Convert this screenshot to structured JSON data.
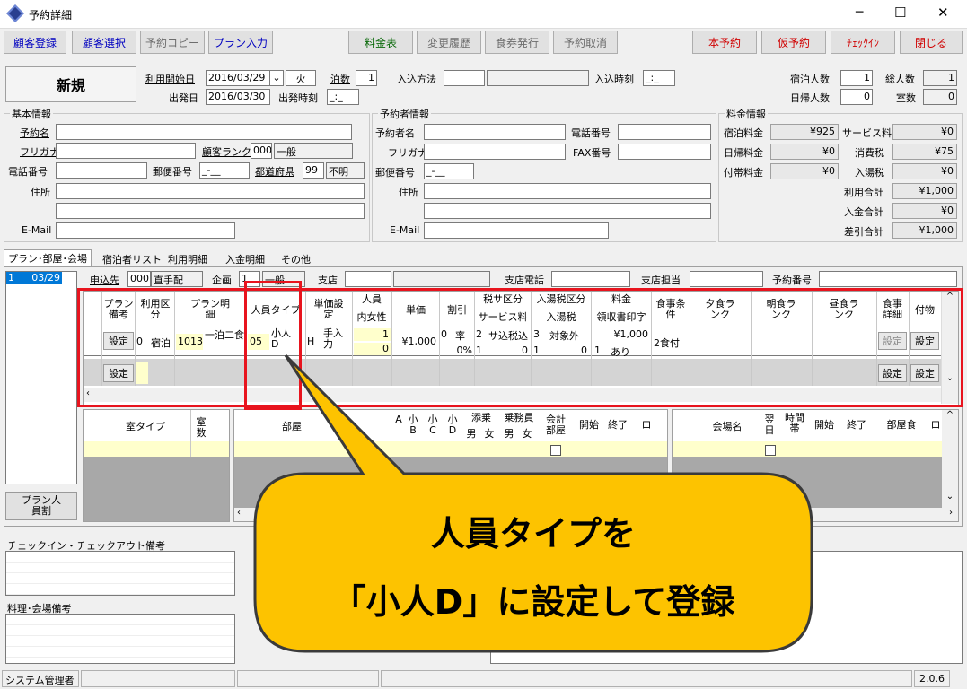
{
  "window": {
    "title": "予約詳細",
    "buttons": [
      "─",
      "☐",
      "✕"
    ]
  },
  "toolbar": {
    "left": [
      "顧客登録",
      "顧客選択",
      "予約コピー",
      "プラン入力"
    ],
    "center": [
      "料金表",
      "変更履歴",
      "食券発行",
      "予約取消"
    ],
    "right": [
      "本予約",
      "仮予約",
      "ﾁｪｯｸｲﾝ",
      "閉じる"
    ]
  },
  "header": {
    "status": "新規",
    "start_date_label": "利用開始日",
    "start_date": "2016/03/29",
    "weekday": "火",
    "nights_label": "泊数",
    "nights": "1",
    "checkin_method_label": "入込方法",
    "checkin_time_label": "入込時刻",
    "checkin_time": "_:_",
    "depart_date_label": "出発日",
    "depart_date": "2016/03/30",
    "depart_time_label": "出発時刻",
    "depart_time": "_:_",
    "stay_people_label": "宿泊人数",
    "stay_people": "1",
    "total_people_label": "総人数",
    "total_people": "1",
    "day_people_label": "日帰人数",
    "day_people": "0",
    "rooms_label": "室数",
    "rooms": "0"
  },
  "basic": {
    "title": "基本情報",
    "name_label": "予約名",
    "kana_label": "フリガナ",
    "rank_label": "顧客ランク",
    "rank_code": "000",
    "rank_name": "一般",
    "phone_label": "電話番号",
    "zip_label": "郵便番号",
    "zip": "_-__",
    "pref_label": "都道府県",
    "pref_code": "99",
    "pref_name": "不明",
    "address_label": "住所",
    "email_label": "E-Mail"
  },
  "booker": {
    "title": "予約者情報",
    "name_label": "予約者名",
    "phone_label": "電話番号",
    "kana_label": "フリガナ",
    "fax_label": "FAX番号",
    "zip_label": "郵便番号",
    "zip": "_-__",
    "address_label": "住所",
    "email_label": "E-Mail"
  },
  "fees": {
    "title": "料金情報",
    "rows": [
      {
        "l1": "宿泊料金",
        "v1": "¥925",
        "l2": "サービス料",
        "v2": "¥0"
      },
      {
        "l1": "日帰料金",
        "v1": "¥0",
        "l2": "消費税",
        "v2": "¥75"
      },
      {
        "l1": "付帯料金",
        "v1": "¥0",
        "l2": "入湯税",
        "v2": "¥0"
      }
    ],
    "totals": [
      {
        "label": "利用合計",
        "value": "¥1,000"
      },
      {
        "label": "入金合計",
        "value": "¥0"
      },
      {
        "label": "差引合計",
        "value": "¥1,000"
      }
    ]
  },
  "tabs": [
    "プラン･部屋･会場",
    "宿泊者リスト",
    "利用明細",
    "入金明細",
    "その他"
  ],
  "plan_list": {
    "item_no": "1",
    "item_date": "03/29",
    "split_button": "プラン人員割"
  },
  "plan_header": {
    "applicant_label": "申込先",
    "applicant_code": "000",
    "applicant_name": "直手配",
    "plan_label": "企画",
    "plan_code": "1",
    "plan_name": "一般",
    "branch_label": "支店",
    "branch_phone_label": "支店電話",
    "branch_staff_label": "支店担当",
    "booking_no_label": "予約番号"
  },
  "plan_grid": {
    "headers": {
      "plan_note": "プラン備考",
      "use_type": "利用区分",
      "plan_detail": "プラン明細",
      "person_type": "人員タイプ",
      "unit_setting": "単価設定",
      "people": "人員",
      "inner_female": "内女性",
      "unit_price": "単価",
      "discount": "割引",
      "tax_type": "税サ区分",
      "service": "サービス料",
      "bath_tax_type": "入湯税区分",
      "bath_tax": "入湯税",
      "fee": "料金",
      "receipt": "領収書印字",
      "meal_cond": "食事条件",
      "dinner_rank": "夕食ランク",
      "breakfast_rank": "朝食ランク",
      "lunch_rank": "昼食ランク",
      "meal_detail": "食事詳細",
      "extras": "付物"
    },
    "row": {
      "note_btn": "設定",
      "use_code": "0",
      "use_name": "宿泊",
      "plan_code": "1013",
      "plan_name": "一泊二食",
      "type_code": "05",
      "type_name": "小人D",
      "unit_code": "H",
      "unit_name": "手入力",
      "people": "1",
      "female": "0",
      "price": "¥1,000",
      "disc_code": "0",
      "disc_name": "率",
      "disc_pct": "0%",
      "disc_val": "1",
      "tax_code": "2",
      "tax_name": "サ込税込",
      "svc": "0",
      "bath_code": "3",
      "bath_name": "対象外",
      "bath_code2": "1",
      "bath_val": "0",
      "fee": "¥1,000",
      "receipt_code": "1",
      "receipt_name": "あり",
      "meal": "2食付",
      "meal_btn": "設定",
      "extras_btn": "設定"
    },
    "empty_row": {
      "note_btn": "設定",
      "meal_btn": "設定",
      "extras_btn": "設定"
    }
  },
  "room_grid": {
    "room_type": "室タイプ",
    "room_count": "室数"
  },
  "room_detail": {
    "room": "部屋",
    "a": "A",
    "small_b": "小B",
    "small_c": "小C",
    "small_d": "小D",
    "companion": "添乗",
    "crew": "乗務員",
    "male": "男",
    "female": "女",
    "account": "会計部屋",
    "start": "開始",
    "end": "終了",
    "lock": "ロ"
  },
  "venue_grid": {
    "venue": "会場名",
    "next_day": "翌日",
    "slot": "時間帯",
    "start": "開始",
    "end": "終了",
    "room_meal": "部屋食",
    "extra": "ロ"
  },
  "notes": {
    "checkin_note": "チェックイン・チェックアウト備考",
    "meal_note": "料理･会場備考"
  },
  "callout": {
    "line1": "人員タイプを",
    "line2": "「小人D」に設定して登録"
  },
  "status": {
    "user": "システム管理者",
    "version": "2.0.6"
  },
  "colors": {
    "highlight": "#e8141e",
    "callout": "#fdc300"
  }
}
